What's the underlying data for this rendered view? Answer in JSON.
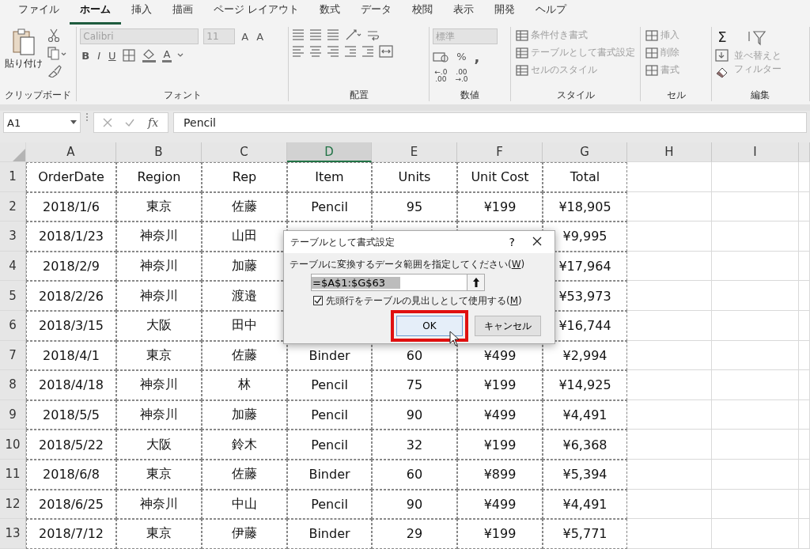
{
  "ribbon_tabs": [
    {
      "label": "ファイル",
      "selected": false
    },
    {
      "label": "ホーム",
      "selected": true
    },
    {
      "label": "挿入",
      "selected": false
    },
    {
      "label": "描画",
      "selected": false
    },
    {
      "label": "ページ レイアウト",
      "selected": false
    },
    {
      "label": "数式",
      "selected": false
    },
    {
      "label": "データ",
      "selected": false
    },
    {
      "label": "校閲",
      "selected": false
    },
    {
      "label": "表示",
      "selected": false
    },
    {
      "label": "開発",
      "selected": false
    },
    {
      "label": "ヘルプ",
      "selected": false
    }
  ],
  "ribbon": {
    "clipboard": {
      "paste_label": "貼り付け",
      "group_label": "クリップボード"
    },
    "font": {
      "name": "Calibri",
      "size": "11",
      "grow": "A",
      "shrink": "A",
      "bold": "B",
      "italic": "I",
      "underline": "U",
      "font_color": "A",
      "group_label": "フォント",
      "disabled": true
    },
    "alignment": {
      "group_label": "配置"
    },
    "number": {
      "format": "標準",
      "percent": "%",
      "comma": ",",
      "decimal_increase": [
        "←.0",
        ".00"
      ],
      "decimal_decrease": [
        ".00",
        "→.0"
      ],
      "group_label": "数値",
      "disabled": true
    },
    "styles": {
      "items": [
        "条件付き書式",
        "テーブルとして書式設定",
        "セルのスタイル"
      ],
      "group_label": "スタイル",
      "disabled": true
    },
    "cells": {
      "items": [
        "挿入",
        "削除",
        "書式"
      ],
      "group_label": "セル",
      "disabled": true
    },
    "editing": {
      "sum": "Σ",
      "sort_filter": [
        "並べ替えと",
        "フィルター"
      ],
      "group_label": "編集",
      "disabled": true
    }
  },
  "formula_bar": {
    "name_box": "A1",
    "fx": "fx",
    "value": "Pencil"
  },
  "sheet": {
    "columns": [
      {
        "label": "A",
        "selected": false
      },
      {
        "label": "B",
        "selected": false
      },
      {
        "label": "C",
        "selected": false
      },
      {
        "label": "D",
        "selected": true
      },
      {
        "label": "E",
        "selected": false
      },
      {
        "label": "F",
        "selected": false
      },
      {
        "label": "G",
        "selected": false
      },
      {
        "label": "H",
        "selected": false
      },
      {
        "label": "I",
        "selected": false
      }
    ],
    "rows": [
      {
        "number": "1",
        "cells": [
          "OrderDate",
          "Region",
          "Rep",
          "Item",
          "Units",
          "Unit Cost",
          "Total"
        ]
      },
      {
        "number": "2",
        "cells": [
          "2018/1/6",
          "東京",
          "佐藤",
          "Pencil",
          "95",
          "¥199",
          "¥18,905"
        ]
      },
      {
        "number": "3",
        "cells": [
          "2018/1/23",
          "神奈川",
          "山田",
          null,
          null,
          null,
          "¥9,995"
        ]
      },
      {
        "number": "4",
        "cells": [
          "2018/2/9",
          "神奈川",
          "加藤",
          null,
          null,
          null,
          "¥17,964"
        ]
      },
      {
        "number": "5",
        "cells": [
          "2018/2/26",
          "神奈川",
          "渡邉",
          null,
          null,
          null,
          "¥53,973"
        ]
      },
      {
        "number": "6",
        "cells": [
          "2018/3/15",
          "大阪",
          "田中",
          null,
          null,
          null,
          "¥16,744"
        ]
      },
      {
        "number": "7",
        "cells": [
          "2018/4/1",
          "東京",
          "佐藤",
          "Binder",
          "60",
          "¥499",
          "¥2,994"
        ]
      },
      {
        "number": "8",
        "cells": [
          "2018/4/18",
          "神奈川",
          "林",
          "Pencil",
          "75",
          "¥199",
          "¥14,925"
        ]
      },
      {
        "number": "9",
        "cells": [
          "2018/5/5",
          "神奈川",
          "加藤",
          "Pencil",
          "90",
          "¥499",
          "¥4,491"
        ]
      },
      {
        "number": "10",
        "cells": [
          "2018/5/22",
          "大阪",
          "鈴木",
          "Pencil",
          "32",
          "¥199",
          "¥6,368"
        ]
      },
      {
        "number": "11",
        "cells": [
          "2018/6/8",
          "東京",
          "佐藤",
          "Binder",
          "60",
          "¥899",
          "¥5,394"
        ]
      },
      {
        "number": "12",
        "cells": [
          "2018/6/25",
          "神奈川",
          "中山",
          "Pencil",
          "90",
          "¥499",
          "¥4,491"
        ]
      },
      {
        "number": "13",
        "cells": [
          "2018/7/12",
          "東京",
          "伊藤",
          "Binder",
          "29",
          "¥199",
          "¥5,771"
        ]
      }
    ]
  },
  "dialog": {
    "title": "テーブルとして書式設定",
    "help": "?",
    "prompt": {
      "text": "テーブルに変換するデータ範囲を指定してください(",
      "key": "W",
      "after": ")"
    },
    "range_value": "=$A$1:$G$63",
    "header_checkbox": {
      "text": "先頭行をテーブルの見出しとして使用する(",
      "key": "M",
      "after": ")",
      "checked": true
    },
    "ok": "OK",
    "cancel": "キャンセル",
    "ok_highlighted": true
  }
}
